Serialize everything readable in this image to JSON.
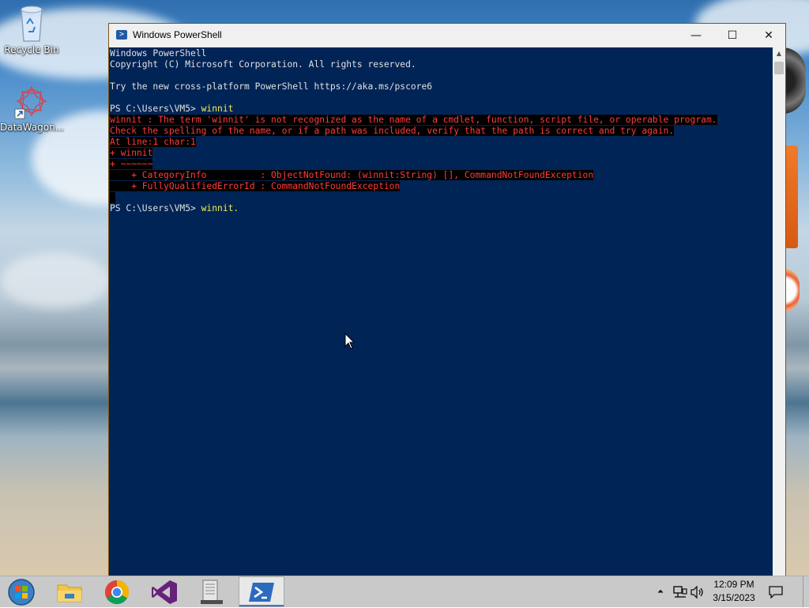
{
  "desktop": {
    "icons": [
      {
        "label": "Recycle Bin",
        "icon": "recycle-bin-icon"
      },
      {
        "label": "DataWagon...",
        "icon": "datawagon-shortcut-icon"
      }
    ]
  },
  "window": {
    "title": "Windows PowerShell",
    "controls": {
      "minimize": "—",
      "maximize": "☐",
      "close": "✕"
    }
  },
  "console": {
    "background": "#012456",
    "lines": [
      {
        "text": "Windows PowerShell",
        "style": "normal"
      },
      {
        "text": "Copyright (C) Microsoft Corporation. All rights reserved.",
        "style": "normal"
      },
      {
        "text": "",
        "style": "normal"
      },
      {
        "text": "Try the new cross-platform PowerShell https://aka.ms/pscore6",
        "style": "normal"
      },
      {
        "text": "",
        "style": "normal"
      },
      {
        "prompt": "PS C:\\Users\\VM5> ",
        "command": "winnit",
        "style": "prompt"
      },
      {
        "text": "winnit : The term 'winnit' is not recognized as the name of a cmdlet, function, script file, or operable program.",
        "style": "error"
      },
      {
        "text": "Check the spelling of the name, or if a path was included, verify that the path is correct and try again.",
        "style": "error"
      },
      {
        "text": "At line:1 char:1",
        "style": "error"
      },
      {
        "text": "+ winnit",
        "style": "error"
      },
      {
        "text": "+ ~~~~~~",
        "style": "error"
      },
      {
        "text": "    + CategoryInfo          : ObjectNotFound: (winnit:String) [], CommandNotFoundException",
        "style": "error"
      },
      {
        "text": "    + FullyQualifiedErrorId : CommandNotFoundException",
        "style": "error"
      },
      {
        "text": "",
        "style": "caret"
      },
      {
        "prompt": "PS C:\\Users\\VM5> ",
        "command": "winnit.",
        "style": "prompt"
      }
    ]
  },
  "taskbar": {
    "items": [
      {
        "name": "start-button",
        "icon": "windows-start-icon"
      },
      {
        "name": "file-explorer",
        "icon": "folder-icon"
      },
      {
        "name": "chrome",
        "icon": "chrome-icon"
      },
      {
        "name": "visual-studio",
        "icon": "visual-studio-icon"
      },
      {
        "name": "file-cabinet",
        "icon": "file-cabinet-icon"
      },
      {
        "name": "powershell",
        "icon": "powershell-icon",
        "active": true
      }
    ],
    "tray": {
      "show_hidden": "⏶",
      "time": "12:09 PM",
      "date": "3/15/2023"
    }
  }
}
